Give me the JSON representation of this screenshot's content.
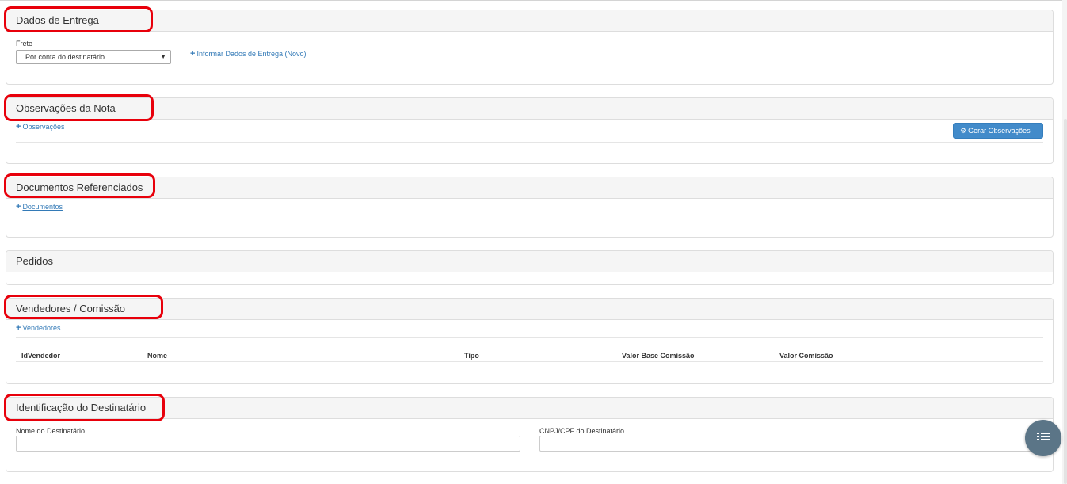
{
  "entrega": {
    "title": "Dados de Entrega",
    "frete_label": "Frete",
    "frete_selected": "Por conta do destinatário",
    "informar_link": "Informar Dados de Entrega (Novo)"
  },
  "observacoes": {
    "title": "Observações da Nota",
    "add_link": "Observações",
    "gerar_button": "Gerar Observações"
  },
  "documentos": {
    "title": "Documentos Referenciados",
    "add_link": "Documentos"
  },
  "pedidos": {
    "title": "Pedidos"
  },
  "vendedores": {
    "title": "Vendedores / Comissão",
    "add_link": "Vendedores",
    "columns": [
      "IdVendedor",
      "Nome",
      "Tipo",
      "Valor Base Comissão",
      "Valor Comissão"
    ]
  },
  "destinatario": {
    "title": "Identificação do Destinatário",
    "nome_label": "Nome do Destinatário",
    "nome_value": "",
    "cnpj_label": "CNPJ/CPF do Destinatário",
    "cnpj_value": ""
  },
  "icons": {
    "plus": "plus-icon",
    "cogs": "cogs-icon",
    "caret": "caret-down-icon",
    "fab": "list-icon"
  },
  "colors": {
    "link": "#337ab7",
    "primary_button": "#428bca",
    "highlight": "#e8000b",
    "fab": "#5b7587"
  }
}
